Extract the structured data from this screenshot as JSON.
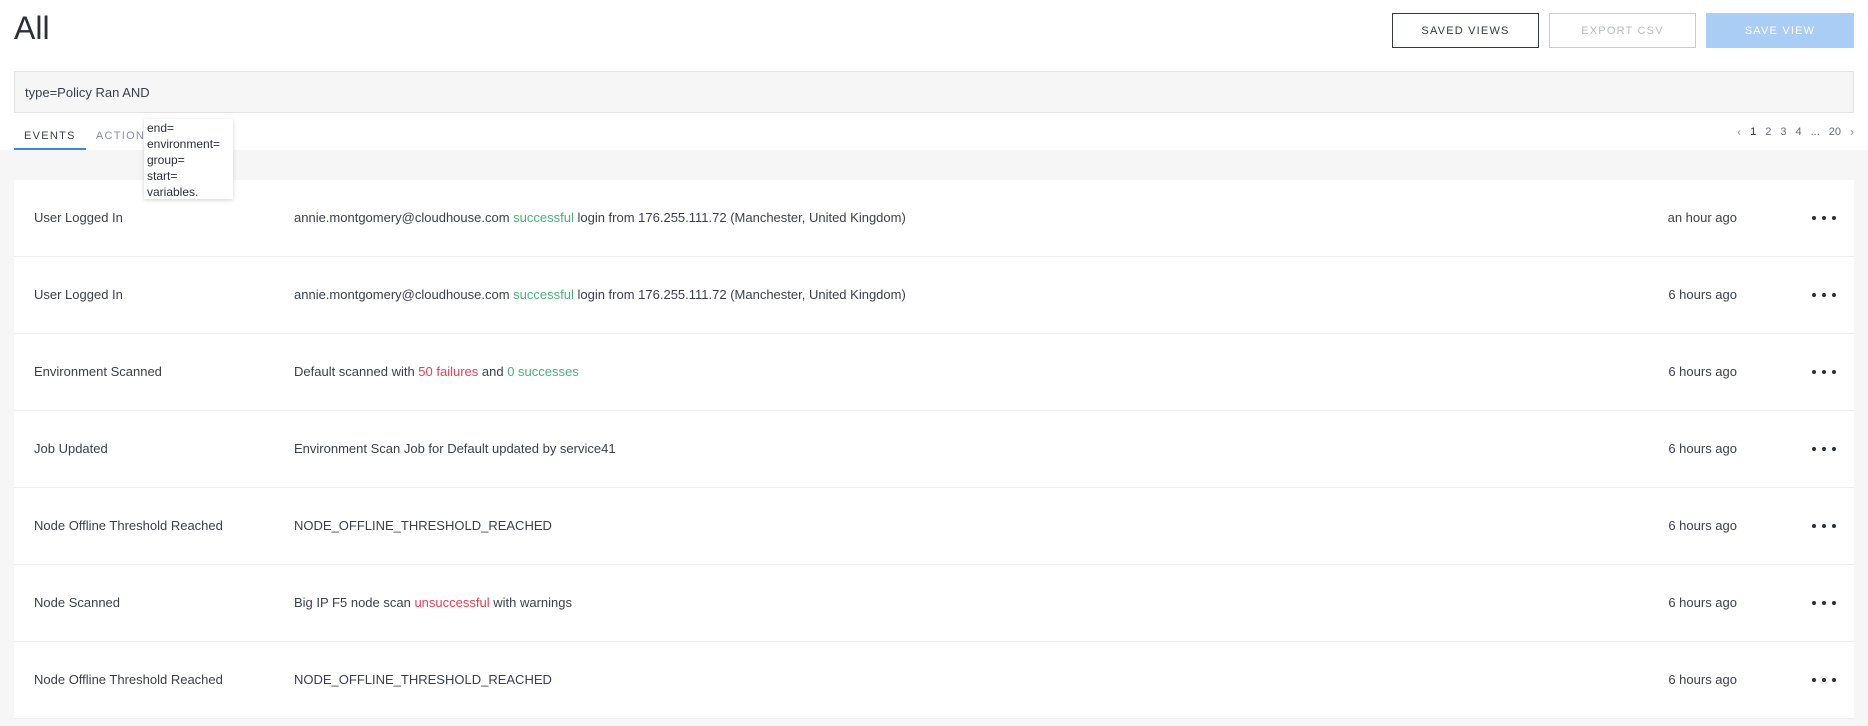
{
  "header": {
    "title": "All",
    "saved_views_label": "SAVED VIEWS",
    "export_csv_label": "EXPORT CSV",
    "save_view_label": "SAVE VIEW"
  },
  "query": {
    "value": "type=Policy Ran AND"
  },
  "tabs": [
    {
      "label": "EVENTS",
      "active": true
    },
    {
      "label": "ACTIONS",
      "active": false
    }
  ],
  "suggestions": [
    "end=",
    "environment=",
    "group=",
    "start=",
    "variables."
  ],
  "pagination": {
    "prev_icon": "chevron-left-icon",
    "next_icon": "chevron-right-icon",
    "pages": [
      "1",
      "2",
      "3",
      "4",
      "...",
      "20"
    ],
    "current": "1"
  },
  "colors": {
    "success": "#4caf7d",
    "failure": "#e0405a",
    "accent": "#3a86d8"
  },
  "events": [
    {
      "type": "User Logged In",
      "desc_pre": "annie.montgomery@cloudhouse.com ",
      "desc_hl1": "successful",
      "desc_mid": " login from 176.255.111.72 (Manchester, United Kingdom)",
      "desc_hl2": "",
      "desc_post": "",
      "time": "an hour ago"
    },
    {
      "type": "User Logged In",
      "desc_pre": "annie.montgomery@cloudhouse.com ",
      "desc_hl1": "successful",
      "desc_mid": " login from 176.255.111.72 (Manchester, United Kingdom)",
      "desc_hl2": "",
      "desc_post": "",
      "time": "6 hours ago"
    },
    {
      "type": "Environment Scanned",
      "desc_pre": "Default scanned with ",
      "desc_hl1": "50 failures",
      "desc_mid": " and ",
      "desc_hl2": "0 successes",
      "desc_post": "",
      "time": "6 hours ago"
    },
    {
      "type": "Job Updated",
      "desc_pre": "Environment Scan Job for Default updated by service41",
      "desc_hl1": "",
      "desc_mid": "",
      "desc_hl2": "",
      "desc_post": "",
      "time": "6 hours ago"
    },
    {
      "type": "Node Offline Threshold Reached",
      "desc_pre": "NODE_OFFLINE_THRESHOLD_REACHED",
      "desc_hl1": "",
      "desc_mid": "",
      "desc_hl2": "",
      "desc_post": "",
      "time": "6 hours ago"
    },
    {
      "type": "Node Scanned",
      "desc_pre": "Big IP F5 node scan ",
      "desc_hl1": "unsuccessful",
      "desc_mid": " with warnings",
      "desc_hl2": "",
      "desc_post": "",
      "time": "6 hours ago"
    },
    {
      "type": "Node Offline Threshold Reached",
      "desc_pre": "NODE_OFFLINE_THRESHOLD_REACHED",
      "desc_hl1": "",
      "desc_mid": "",
      "desc_hl2": "",
      "desc_post": "",
      "time": "6 hours ago"
    }
  ]
}
